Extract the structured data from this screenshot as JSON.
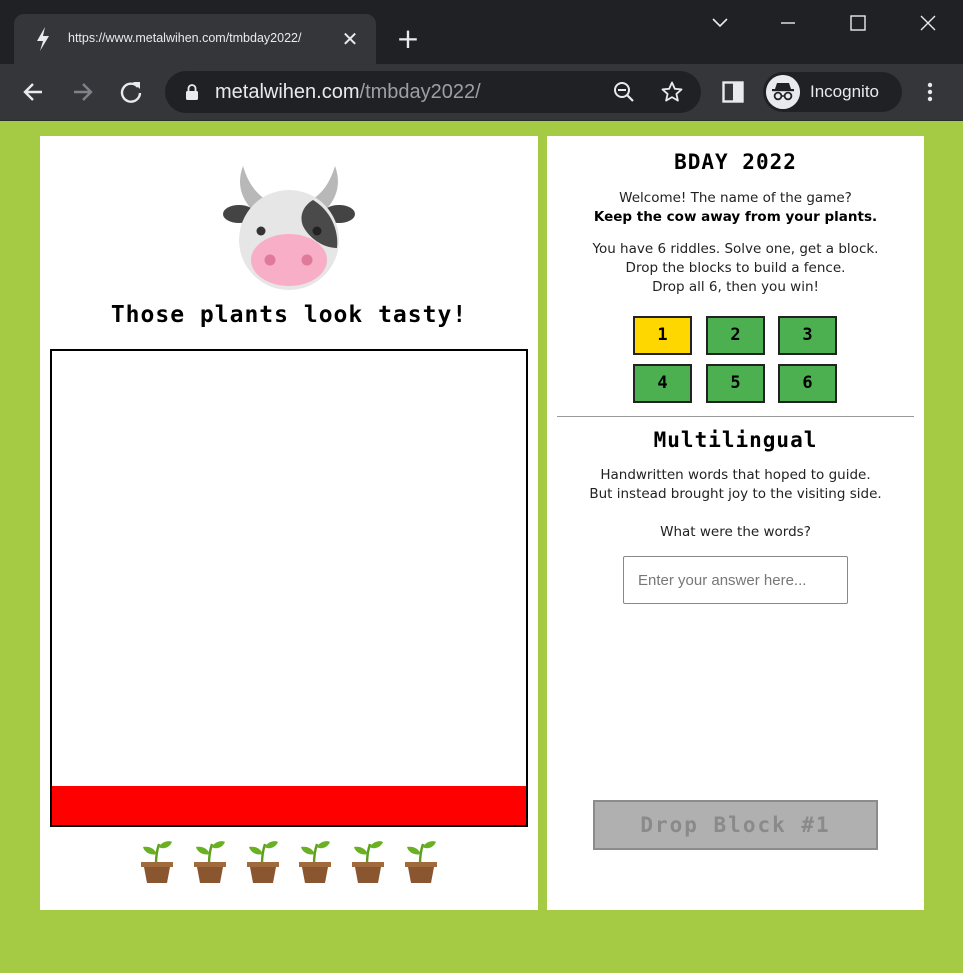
{
  "browser": {
    "tab_title": "https://www.metalwihen.com/tmbday2022/",
    "url_host": "metalwihen.com",
    "url_path": "/tmbday2022/",
    "profile_label": "Incognito",
    "tab_close": "✕",
    "new_tab": "+"
  },
  "game": {
    "cow_caption": "Those plants look tasty!",
    "plant_count": 6,
    "colors": {
      "background": "#a5cb44",
      "fence_zone": "#ff0000",
      "riddle_solved": "#4caf50",
      "riddle_active": "#ffd700"
    }
  },
  "sidebar": {
    "title": "BDAY 2022",
    "intro_line1": "Welcome! The name of the game?",
    "intro_line2": "Keep the cow away from your plants.",
    "rules_line1": "You have 6 riddles. Solve one, get a block.",
    "rules_line2": "Drop the blocks to build a fence.",
    "rules_line3": "Drop all 6, then you win!",
    "riddle_buttons": [
      "1",
      "2",
      "3",
      "4",
      "5",
      "6"
    ],
    "active_riddle": "1"
  },
  "riddle": {
    "title": "Multilingual",
    "line1": "Handwritten words that hoped to guide.",
    "line2": "But instead brought joy to the visiting side.",
    "question": "What were the words?",
    "answer_placeholder": "Enter your answer here...",
    "answer_value": "",
    "drop_button": "Drop Block #1"
  }
}
